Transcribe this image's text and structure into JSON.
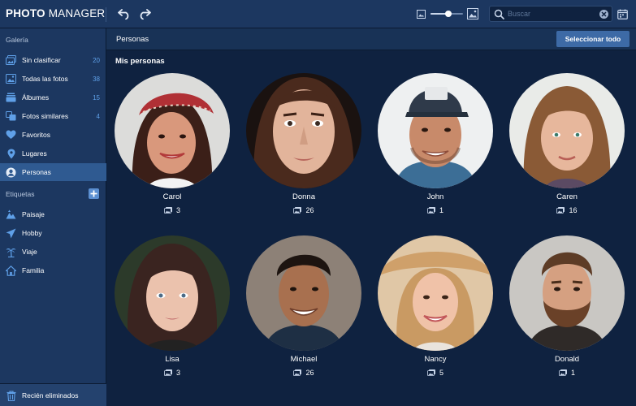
{
  "app": {
    "logo_bold": "PHOTO",
    "logo_light": "MANAGER"
  },
  "toolbar": {
    "zoom_level": 0.55,
    "search_placeholder": "Buscar"
  },
  "sidebar": {
    "gallery_title": "Galería",
    "gallery_items": [
      {
        "label": "Sin clasificar",
        "count": "20",
        "icon": "unsorted-icon"
      },
      {
        "label": "Todas las fotos",
        "count": "38",
        "icon": "all-photos-icon"
      },
      {
        "label": "Álbumes",
        "count": "15",
        "icon": "albums-icon"
      },
      {
        "label": "Fotos similares",
        "count": "4",
        "icon": "similar-photos-icon"
      },
      {
        "label": "Favoritos",
        "count": "",
        "icon": "heart-icon"
      },
      {
        "label": "Lugares",
        "count": "",
        "icon": "location-pin-icon"
      },
      {
        "label": "Personas",
        "count": "",
        "icon": "person-icon",
        "active": true
      }
    ],
    "tags_title": "Etiquetas",
    "tags": [
      {
        "label": "Paisaje",
        "icon": "landscape-icon"
      },
      {
        "label": "Hobby",
        "icon": "plane-icon"
      },
      {
        "label": "Viaje",
        "icon": "palm-tree-icon"
      },
      {
        "label": "Familia",
        "icon": "home-icon"
      }
    ],
    "trash_label": "Recién eliminados"
  },
  "main": {
    "title": "Personas",
    "select_all": "Seleccionar todo",
    "section_title": "Mis personas",
    "people": [
      {
        "name": "Carol",
        "count": "3"
      },
      {
        "name": "Donna",
        "count": "26"
      },
      {
        "name": "John",
        "count": "1"
      },
      {
        "name": "Caren",
        "count": "16"
      },
      {
        "name": "Lisa",
        "count": "3"
      },
      {
        "name": "Michael",
        "count": "26"
      },
      {
        "name": "Nancy",
        "count": "5"
      },
      {
        "name": "Donald",
        "count": "1"
      }
    ]
  },
  "colors": {
    "accent": "#5fa0e8",
    "sidebar_bg": "#1c3760",
    "content_bg": "#0f2240",
    "active_item": "#2f5a91",
    "button": "#3d6aa6"
  }
}
